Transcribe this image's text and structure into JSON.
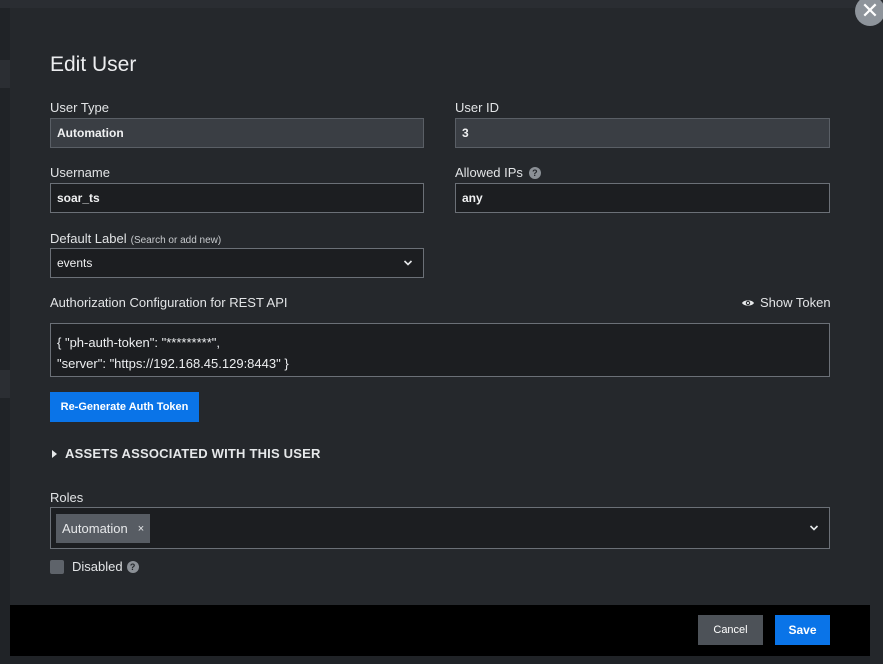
{
  "modal": {
    "title": "Edit User",
    "close_glyph": "✕",
    "close_icon": "close-icon"
  },
  "form": {
    "user_type": {
      "label": "User Type",
      "value": "Automation"
    },
    "user_id": {
      "label": "User ID",
      "value": "3"
    },
    "username": {
      "label": "Username",
      "value": "soar_ts"
    },
    "allowed_ips": {
      "label": "Allowed IPs",
      "value": "any",
      "help_glyph": "?"
    },
    "default_label": {
      "label": "Default Label",
      "hint": "(Search or add new)",
      "value": "events"
    },
    "auth_config": {
      "label": "Authorization Configuration for REST API",
      "show_token": "Show Token",
      "line1": "{ \"ph-auth-token\": \"*********\",",
      "line2": "\"server\": \"https://192.168.45.129:8443\" }"
    },
    "regen_button": "Re-Generate Auth Token",
    "assets_section": "ASSETS ASSOCIATED WITH THIS USER",
    "roles": {
      "label": "Roles",
      "chips": [
        "Automation"
      ],
      "chip_remove": "×"
    },
    "disabled": {
      "label": "Disabled",
      "checked": false,
      "help_glyph": "?"
    }
  },
  "footer": {
    "cancel_label": "Cancel",
    "save_label": "Save"
  },
  "colors": {
    "primary": "#0a74e8",
    "modal_bg": "#25282c",
    "footer_bg": "#000000"
  }
}
